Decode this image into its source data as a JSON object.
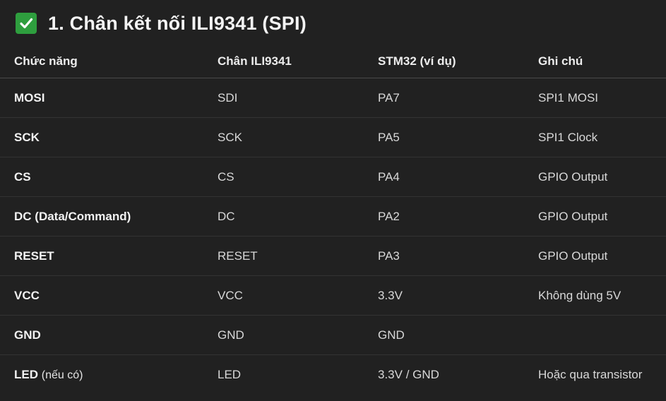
{
  "heading": {
    "text": "1. Chân kết nối ILI9341 (SPI)"
  },
  "table": {
    "headers": [
      "Chức năng",
      "Chân ILI9341",
      "STM32 (ví dụ)",
      "Ghi chú"
    ],
    "rows": [
      {
        "func": "MOSI",
        "func_note": "",
        "pin": "SDI",
        "stm32": "PA7",
        "note": "SPI1 MOSI"
      },
      {
        "func": "SCK",
        "func_note": "",
        "pin": "SCK",
        "stm32": "PA5",
        "note": "SPI1 Clock"
      },
      {
        "func": "CS",
        "func_note": "",
        "pin": "CS",
        "stm32": "PA4",
        "note": "GPIO Output"
      },
      {
        "func": "DC (Data/Command)",
        "func_note": "",
        "pin": "DC",
        "stm32": "PA2",
        "note": "GPIO Output"
      },
      {
        "func": "RESET",
        "func_note": "",
        "pin": "RESET",
        "stm32": "PA3",
        "note": "GPIO Output"
      },
      {
        "func": "VCC",
        "func_note": "",
        "pin": "VCC",
        "stm32": "3.3V",
        "note": "Không dùng 5V"
      },
      {
        "func": "GND",
        "func_note": "",
        "pin": "GND",
        "stm32": "GND",
        "note": ""
      },
      {
        "func": "LED",
        "func_note": "(nếu có)",
        "pin": "LED",
        "stm32": "3.3V / GND",
        "note": "Hoặc qua transistor"
      }
    ]
  }
}
